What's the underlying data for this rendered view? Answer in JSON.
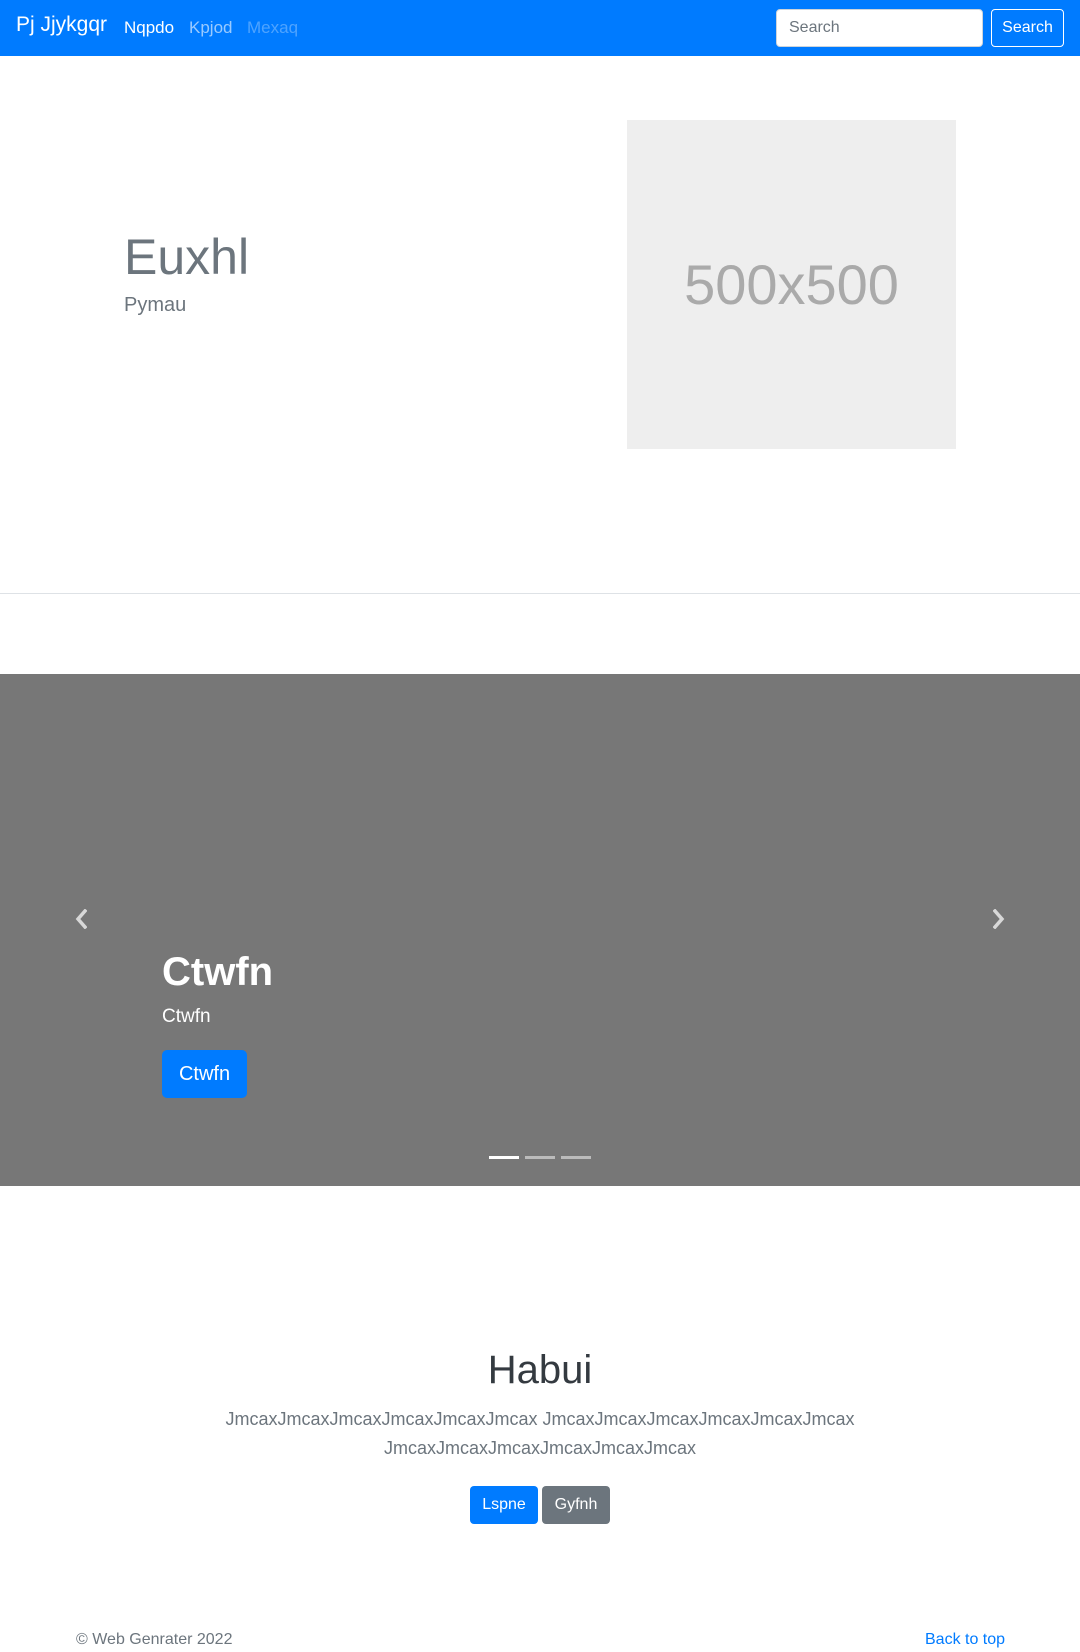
{
  "navbar": {
    "brand": "Pj Jjykgqr",
    "links": [
      {
        "label": "Nqpdo",
        "state": "active"
      },
      {
        "label": "Kpjod",
        "state": "normal"
      },
      {
        "label": "Mexaq",
        "state": "disabled"
      }
    ],
    "search_placeholder": "Search",
    "search_button": "Search"
  },
  "hero": {
    "title": "Euxhl",
    "subtitle": "Pymau",
    "image_label": "500x500"
  },
  "carousel": {
    "title": "Ctwfn",
    "subtitle": "Ctwfn",
    "button": "Ctwfn",
    "slide_count": 3,
    "active_index": 0,
    "prev_icon": "chevron-left-icon",
    "next_icon": "chevron-right-icon"
  },
  "section": {
    "title": "Habui",
    "text": "JmcaxJmcaxJmcaxJmcaxJmcaxJmcax JmcaxJmcaxJmcaxJmcaxJmcaxJmcax JmcaxJmcaxJmcaxJmcaxJmcaxJmcax",
    "primary_button": "Lspne",
    "secondary_button": "Gyfnh"
  },
  "footer": {
    "copyright": "© Web Genrater 2022",
    "back_to_top": "Back to top"
  },
  "colors": {
    "primary": "#007bff",
    "secondary": "#6c757d",
    "carousel_bg": "#777777",
    "placeholder_bg": "#eeeeee"
  }
}
